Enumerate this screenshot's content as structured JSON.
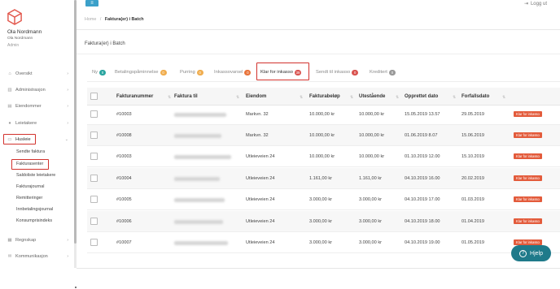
{
  "topbar": {
    "menu_icon": "hamburger-icon",
    "logout_label": "Logg ut",
    "logout_icon": "logout-icon"
  },
  "user": {
    "name": "Ola Nordmann",
    "subtitle": "Ola Nordmann",
    "role": "Admin"
  },
  "sidebar": {
    "items": [
      {
        "label": "Oversikt",
        "icon": "home-icon"
      },
      {
        "label": "Administrasjon",
        "icon": "bank-icon"
      },
      {
        "label": "Eiendommer",
        "icon": "building-icon"
      },
      {
        "label": "Leietakere",
        "icon": "users-icon"
      },
      {
        "label": "Husleie",
        "icon": "money-icon"
      },
      {
        "label": "Regnskap",
        "icon": "calculator-icon"
      },
      {
        "label": "Kommunikasjon",
        "icon": "chat-icon"
      }
    ],
    "sub_items": [
      "Sendte faktura",
      "Fakturasenter",
      "Saldoliste leietakere",
      "Fakturajournal",
      "Remitteringer",
      "Innbetalingsjournal",
      "Konsumprisindeks"
    ]
  },
  "breadcrumb": {
    "home": "Home",
    "separator": "/",
    "current": "Faktura(er) i Batch"
  },
  "panel": {
    "title": "Faktura(er) i Batch"
  },
  "tabs": [
    {
      "label": "Ny",
      "count": "0",
      "color": "#2aa5a0"
    },
    {
      "label": "Betalingspåminnelse",
      "count": "0",
      "color": "#f0ad4e"
    },
    {
      "label": "Purring",
      "count": "0",
      "color": "#f0ad4e"
    },
    {
      "label": "Inkassovarsel",
      "count": "0",
      "color": "#e8743b"
    },
    {
      "label": "Klar for inkasso",
      "count": "39",
      "color": "#d9534f"
    },
    {
      "label": "Sendt til inkasso",
      "count": "0",
      "color": "#d9534f"
    },
    {
      "label": "Kreditert",
      "count": "0",
      "color": "#999999"
    }
  ],
  "table": {
    "columns": [
      "Fakturanummer",
      "Faktura til",
      "Eiendom",
      "Fakturabeløp",
      "Utestående",
      "Opprettet dato",
      "Forfallsdato"
    ],
    "rows": [
      {
        "nr": "#10003",
        "eiendom": "Markvn. 32",
        "belop": "10.000,00 kr",
        "utestaende": "10.000,00 kr",
        "opprettet": "15.05.2019 13.57",
        "forfall": "29.05.2019",
        "status": "Klar for inkasso"
      },
      {
        "nr": "#10008",
        "eiendom": "Markvn. 32",
        "belop": "10.000,00 kr",
        "utestaende": "10.000,00 kr",
        "opprettet": "01.06.2019 8.07",
        "forfall": "15.06.2019",
        "status": "Klar for inkasso"
      },
      {
        "nr": "#10003",
        "eiendom": "Utleieveien 24",
        "belop": "10.000,00 kr",
        "utestaende": "10.000,00 kr",
        "opprettet": "01.10.2019 12.00",
        "forfall": "15.10.2019",
        "status": "Klar for inkasso"
      },
      {
        "nr": "#10004",
        "eiendom": "Utleieveien 24",
        "belop": "1.161,00 kr",
        "utestaende": "1.161,00 kr",
        "opprettet": "04.10.2019 16.00",
        "forfall": "20.02.2019",
        "status": "Klar for inkasso"
      },
      {
        "nr": "#10005",
        "eiendom": "Utleieveien 24",
        "belop": "3.000,00 kr",
        "utestaende": "3.000,00 kr",
        "opprettet": "04.10.2019 17.00",
        "forfall": "01.03.2019",
        "status": "Klar for inkasso"
      },
      {
        "nr": "#10006",
        "eiendom": "Utleieveien 24",
        "belop": "3.000,00 kr",
        "utestaende": "3.000,00 kr",
        "opprettet": "04.10.2019 18.00",
        "forfall": "01.04.2019",
        "status": "Klar for inkasso"
      },
      {
        "nr": "#10007",
        "eiendom": "Utleieveien 24",
        "belop": "3.000,00 kr",
        "utestaende": "3.000,00 kr",
        "opprettet": "04.10.2019 19.00",
        "forfall": "01.05.2019",
        "status": "Klar for inkasso"
      }
    ]
  },
  "help": {
    "label": "Hjelp",
    "icon": "help-icon"
  },
  "colors": {
    "accent": "#3ba0c9",
    "highlight": "#d2322d",
    "status": "#e35b3b",
    "help": "#1f7a8a"
  }
}
